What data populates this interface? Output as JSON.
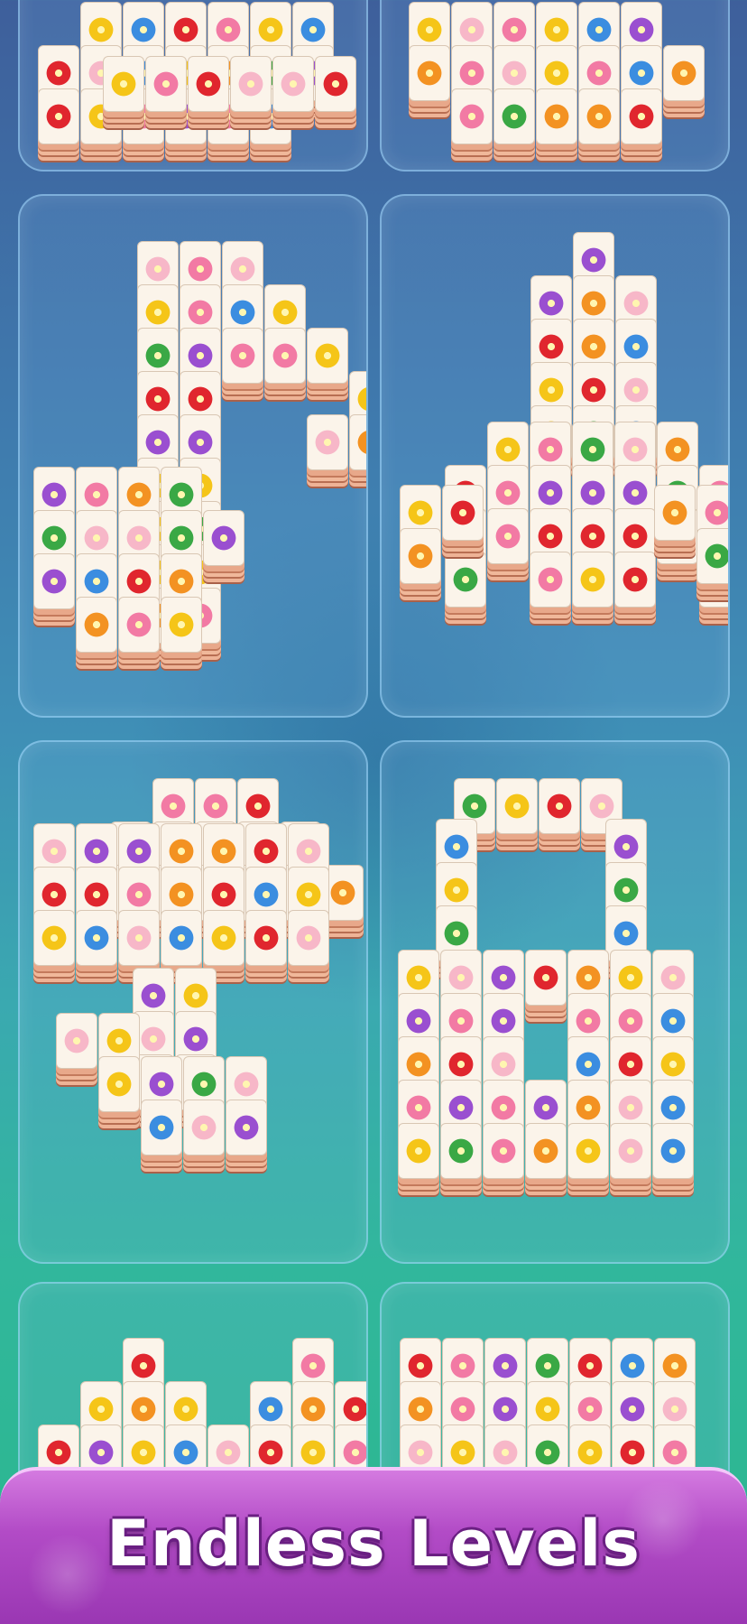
{
  "banner": {
    "title": "Endless Levels"
  },
  "colors": {
    "red": "#e0262e",
    "pink": "#f27aa4",
    "orange": "#f39222",
    "yellow": "#f5c518",
    "blue": "#3b8de0",
    "purple": "#9a4fd0",
    "green": "#3aa845",
    "lightpink": "#f7b7c8"
  },
  "levels": [
    {
      "name": "level-1",
      "shape": "partial-top-left"
    },
    {
      "name": "level-2",
      "shape": "partial-top-right"
    },
    {
      "name": "level-3",
      "shape": "music-note"
    },
    {
      "name": "level-4",
      "shape": "rocket"
    },
    {
      "name": "level-5",
      "shape": "umbrella"
    },
    {
      "name": "level-6",
      "shape": "padlock"
    },
    {
      "name": "level-7",
      "shape": "hearts"
    },
    {
      "name": "level-8",
      "shape": "rectangle-grid"
    }
  ]
}
